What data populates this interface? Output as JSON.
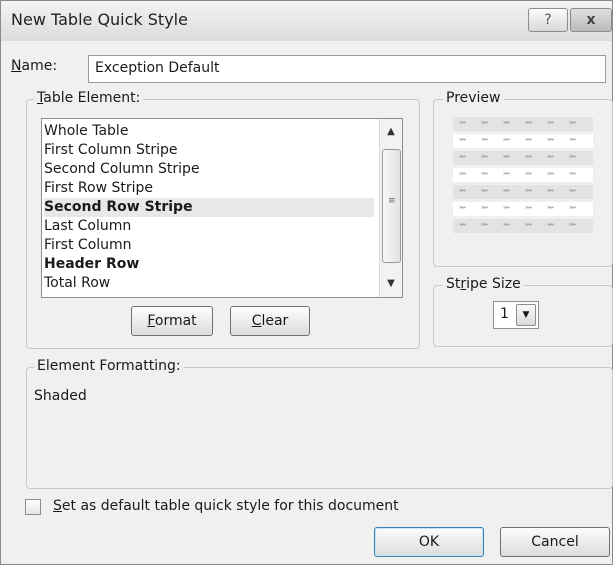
{
  "window": {
    "title": "New Table Quick Style",
    "help_button": "?",
    "close_button": "x"
  },
  "name_field": {
    "label_prefix": "",
    "label_mnemonic": "N",
    "label_rest": "ame:",
    "value": "Exception Default"
  },
  "table_element": {
    "group_mnemonic": "T",
    "group_rest": "able Element:",
    "items": [
      {
        "label": "Whole Table",
        "bold": false,
        "selected": false
      },
      {
        "label": "First Column Stripe",
        "bold": false,
        "selected": false
      },
      {
        "label": "Second Column Stripe",
        "bold": false,
        "selected": false
      },
      {
        "label": "First Row Stripe",
        "bold": false,
        "selected": false
      },
      {
        "label": "Second Row Stripe",
        "bold": true,
        "selected": true
      },
      {
        "label": "Last Column",
        "bold": false,
        "selected": false
      },
      {
        "label": "First Column",
        "bold": false,
        "selected": false
      },
      {
        "label": "Header Row",
        "bold": true,
        "selected": false
      },
      {
        "label": "Total Row",
        "bold": false,
        "selected": false
      }
    ],
    "format_mnemonic": "F",
    "format_rest": "ormat",
    "clear_mnemonic": "C",
    "clear_rest": "lear"
  },
  "preview": {
    "title": "Preview",
    "cell_text": "»»»",
    "rows": [
      {
        "shaded": true
      },
      {
        "shaded": false
      },
      {
        "shaded": true
      },
      {
        "shaded": false
      },
      {
        "shaded": true
      },
      {
        "shaded": false
      },
      {
        "shaded": true
      }
    ]
  },
  "stripe_size": {
    "title_pre": "St",
    "title_mnemonic": "r",
    "title_rest": "ipe Size",
    "value": "1"
  },
  "element_formatting": {
    "title": "Element Formatting:",
    "text": "Shaded"
  },
  "default_checkbox": {
    "mnemonic": "S",
    "rest": "et as default table quick style for this document",
    "checked": false
  },
  "buttons": {
    "ok": "OK",
    "cancel": "Cancel"
  },
  "colors": {
    "preview_shade": "#e3e3e3",
    "preview_plain": "#ffffff"
  }
}
